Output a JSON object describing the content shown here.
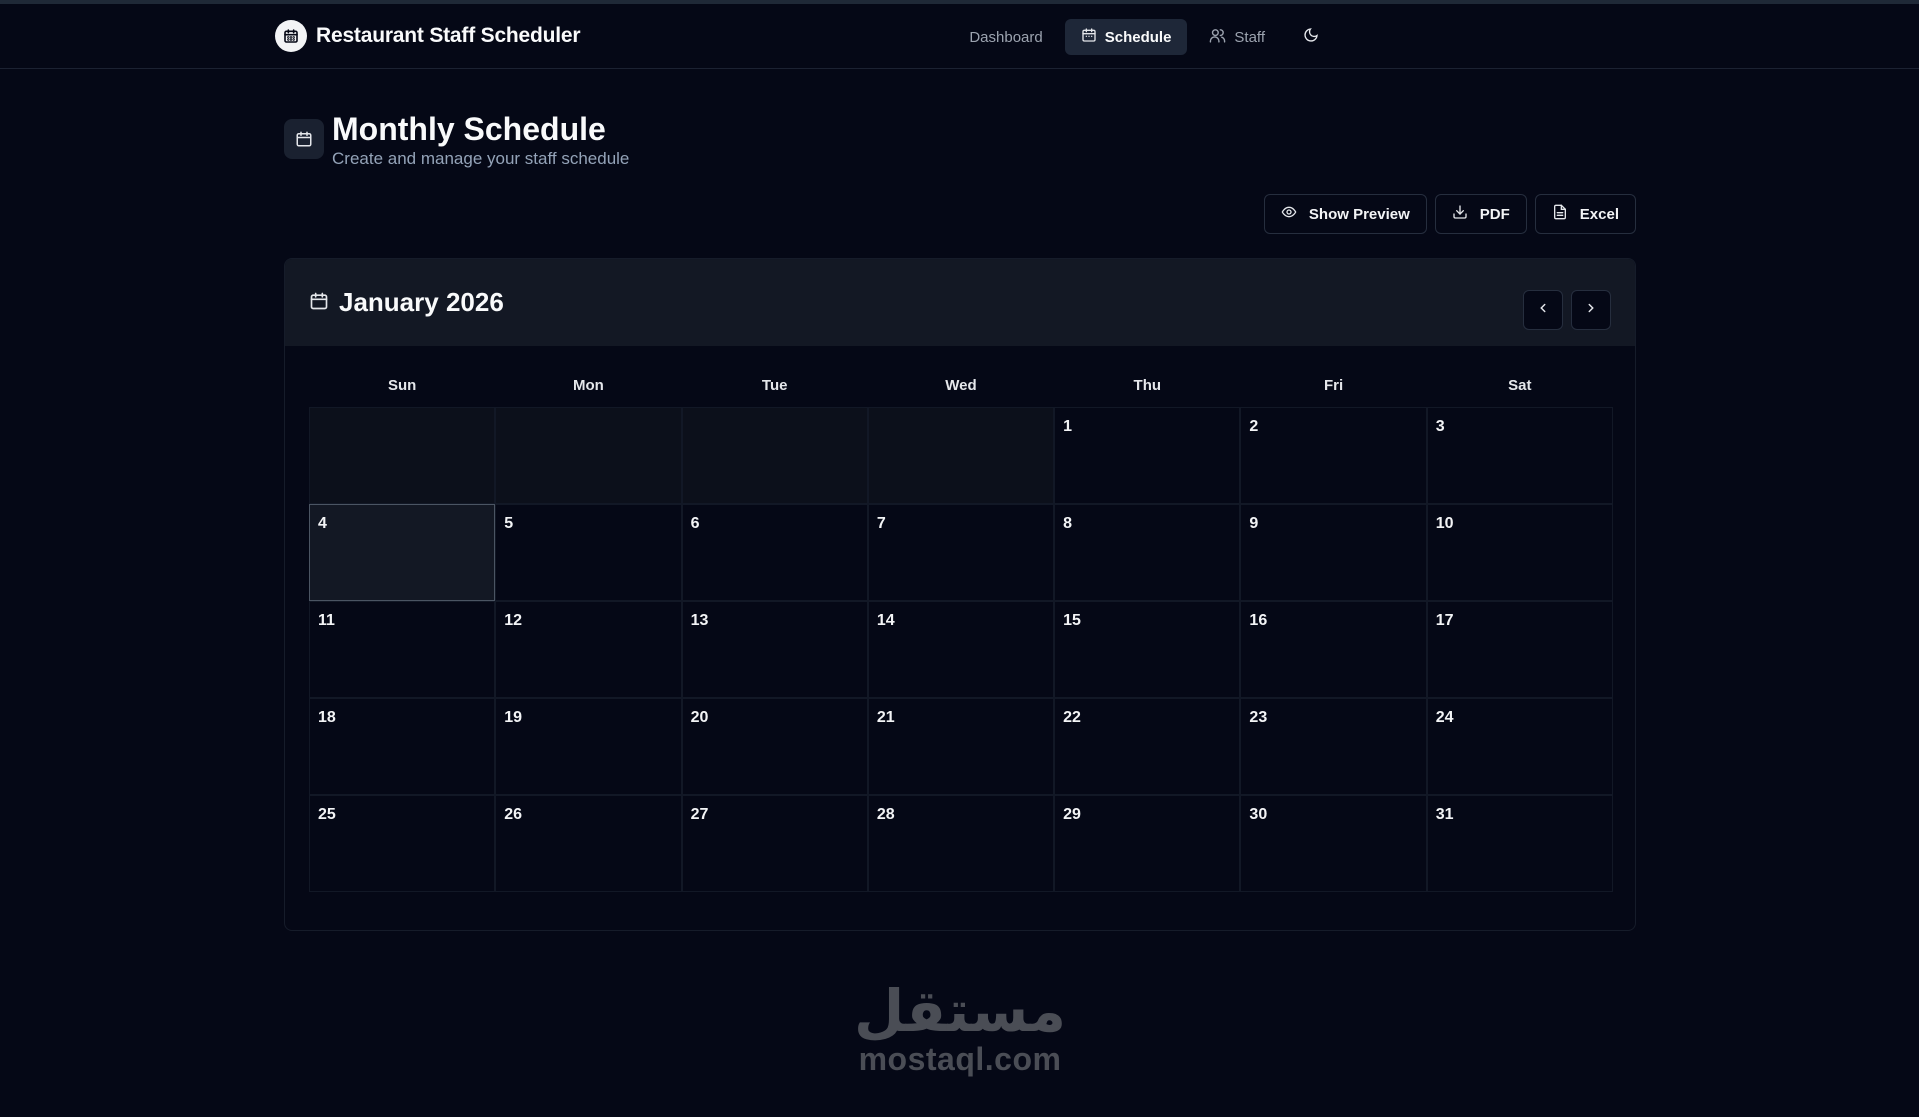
{
  "app": {
    "title": "Restaurant Staff Scheduler"
  },
  "nav": {
    "items": [
      {
        "label": "Dashboard",
        "icon": "none",
        "active": false
      },
      {
        "label": "Schedule",
        "icon": "calendar-icon",
        "active": true
      },
      {
        "label": "Staff",
        "icon": "users-icon",
        "active": false
      }
    ],
    "theme_toggle_icon": "moon-icon"
  },
  "page": {
    "title": "Monthly Schedule",
    "subtitle": "Create and manage your staff schedule"
  },
  "actions": {
    "preview_label": "Show Preview",
    "pdf_label": "PDF",
    "excel_label": "Excel"
  },
  "calendar": {
    "month_label": "January 2026",
    "weekdays": [
      "Sun",
      "Mon",
      "Tue",
      "Wed",
      "Thu",
      "Fri",
      "Sat"
    ],
    "leading_empty_days": 4,
    "days": [
      "1",
      "2",
      "3",
      "4",
      "5",
      "6",
      "7",
      "8",
      "9",
      "10",
      "11",
      "12",
      "13",
      "14",
      "15",
      "16",
      "17",
      "18",
      "19",
      "20",
      "21",
      "22",
      "23",
      "24",
      "25",
      "26",
      "27",
      "28",
      "29",
      "30",
      "31"
    ],
    "today": "4"
  },
  "watermark": {
    "arabic": "مستقل",
    "latin": "mostaql.com"
  },
  "colors": {
    "background": "#050816",
    "card_header": "#131824",
    "active_nav": "#1e2738",
    "muted_text": "#94a3b8",
    "border": "#262e3e"
  }
}
